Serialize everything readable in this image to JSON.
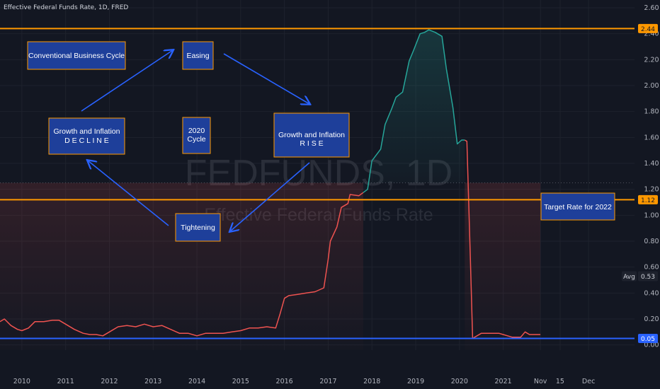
{
  "header": {
    "title": "Effective Federal Funds Rate, 1D, FRED"
  },
  "watermark": {
    "symbol": "FEDFUNDS, 1D",
    "name": "Effective Federal Funds Rate"
  },
  "colors": {
    "background": "#131722",
    "grid": "#1e222d",
    "rise_line": "#26a69a",
    "fall_line": "#ef5350",
    "orange": "#ff9800",
    "blue": "#2962ff",
    "box_fill": "#1e3f9a",
    "box_border": "#ff9800",
    "arrow": "#2962ff"
  },
  "chart_data": {
    "type": "area",
    "ylim": [
      -0.04,
      2.66
    ],
    "xlim": [
      2009.5,
      2024.0
    ],
    "y_ticks": [
      "0.00",
      "0.20",
      "0.40",
      "0.60",
      "0.80",
      "1.00",
      "1.20",
      "1.40",
      "1.60",
      "1.80",
      "2.00",
      "2.20",
      "2.40",
      "2.60"
    ],
    "x_ticks": [
      {
        "label": "2010",
        "x": 2010.0
      },
      {
        "label": "2011",
        "x": 2011.0
      },
      {
        "label": "2012",
        "x": 2012.0
      },
      {
        "label": "2013",
        "x": 2013.0
      },
      {
        "label": "2014",
        "x": 2014.0
      },
      {
        "label": "2015",
        "x": 2015.0
      },
      {
        "label": "2016",
        "x": 2016.0
      },
      {
        "label": "2017",
        "x": 2017.0
      },
      {
        "label": "2018",
        "x": 2018.0
      },
      {
        "label": "2019",
        "x": 2019.0
      },
      {
        "label": "2020",
        "x": 2020.0
      },
      {
        "label": "2021",
        "x": 2021.0
      },
      {
        "label": "Nov",
        "x": 2021.85
      },
      {
        "label": "15",
        "x": 2022.3
      },
      {
        "label": "Dec",
        "x": 2022.95
      }
    ],
    "series": [
      {
        "x": [
          2009.5,
          2009.6,
          2009.75,
          2009.9,
          2010.0,
          2010.15,
          2010.3,
          2010.5,
          2010.7,
          2010.85,
          2011.0,
          2011.2,
          2011.4,
          2011.55,
          2011.7,
          2011.85,
          2012.0,
          2012.2,
          2012.4,
          2012.6,
          2012.8,
          2013.0,
          2013.2,
          2013.4,
          2013.6,
          2013.8,
          2014.0,
          2014.2,
          2014.4,
          2014.6,
          2014.8,
          2015.0,
          2015.2,
          2015.4,
          2015.6,
          2015.8,
          2015.9,
          2016.0,
          2016.1,
          2016.3,
          2016.5,
          2016.7,
          2016.9,
          2017.0,
          2017.05,
          2017.2,
          2017.3,
          2017.45,
          2017.5,
          2017.7,
          2017.9,
          2018.0,
          2018.2,
          2018.3,
          2018.45,
          2018.55,
          2018.7,
          2018.85,
          2018.95,
          2019.1,
          2019.2,
          2019.3,
          2019.45,
          2019.5,
          2019.6,
          2019.7,
          2019.85,
          2019.95,
          2020.05,
          2020.12,
          2020.17,
          2020.25,
          2020.3,
          2020.5,
          2020.7,
          2020.9,
          2021.0,
          2021.2,
          2021.4,
          2021.5,
          2021.6,
          2021.75,
          2021.85
        ],
        "y": [
          0.18,
          0.2,
          0.15,
          0.12,
          0.11,
          0.13,
          0.18,
          0.18,
          0.19,
          0.19,
          0.16,
          0.12,
          0.09,
          0.08,
          0.08,
          0.07,
          0.1,
          0.14,
          0.15,
          0.14,
          0.16,
          0.14,
          0.15,
          0.12,
          0.09,
          0.09,
          0.07,
          0.09,
          0.09,
          0.09,
          0.1,
          0.11,
          0.13,
          0.13,
          0.14,
          0.13,
          0.24,
          0.36,
          0.38,
          0.39,
          0.4,
          0.41,
          0.44,
          0.66,
          0.8,
          0.91,
          1.06,
          1.09,
          1.16,
          1.15,
          1.2,
          1.42,
          1.51,
          1.7,
          1.82,
          1.91,
          1.95,
          2.19,
          2.27,
          2.4,
          2.41,
          2.43,
          2.41,
          2.4,
          2.38,
          2.13,
          1.83,
          1.55,
          1.58,
          1.58,
          1.57,
          0.65,
          0.05,
          0.09,
          0.09,
          0.09,
          0.08,
          0.06,
          0.06,
          0.1,
          0.08,
          0.08,
          0.08
        ],
        "segments": [
          {
            "start_x": 2009.5,
            "end_x": 2017.8,
            "color": "fall"
          },
          {
            "start_x": 2017.8,
            "end_x": 2020.12,
            "color": "rise"
          },
          {
            "start_x": 2020.12,
            "end_x": 2021.85,
            "color": "fall"
          }
        ]
      }
    ],
    "horizontal_lines": [
      {
        "name": "top",
        "y": 2.44,
        "color": "#ff9800",
        "tag": "2.44",
        "tag_bg": "#ff9800",
        "tag_fg": "#131722"
      },
      {
        "name": "target",
        "y": 1.12,
        "color": "#ff9800",
        "tag": "1.12",
        "tag_bg": "#ff9800",
        "tag_fg": "#131722"
      },
      {
        "name": "low",
        "y": 0.05,
        "color": "#2962ff",
        "tag": "0.05",
        "tag_bg": "#2962ff",
        "tag_fg": "#ffffff"
      }
    ],
    "dotted_line": {
      "y": 1.25
    },
    "avg": {
      "label": "Avg",
      "value": "0.53",
      "y": 0.53
    }
  },
  "annotations": {
    "conventional": {
      "lines": [
        "Conventional Business Cycle"
      ],
      "spaced": false
    },
    "easing": {
      "lines": [
        "Easing"
      ],
      "spaced": false
    },
    "decline": {
      "lines": [
        "Growth and Inflation",
        "D E C L I N E"
      ],
      "spaced": true
    },
    "cycle2020": {
      "lines": [
        "2020",
        "Cycle"
      ],
      "spaced": false
    },
    "rise": {
      "lines": [
        "Growth and Inflation",
        "R I S E"
      ],
      "spaced": true
    },
    "tightening": {
      "lines": [
        "Tightening"
      ],
      "spaced": false
    },
    "target": {
      "lines": [
        "Target Rate for 2022"
      ],
      "spaced": false
    }
  }
}
